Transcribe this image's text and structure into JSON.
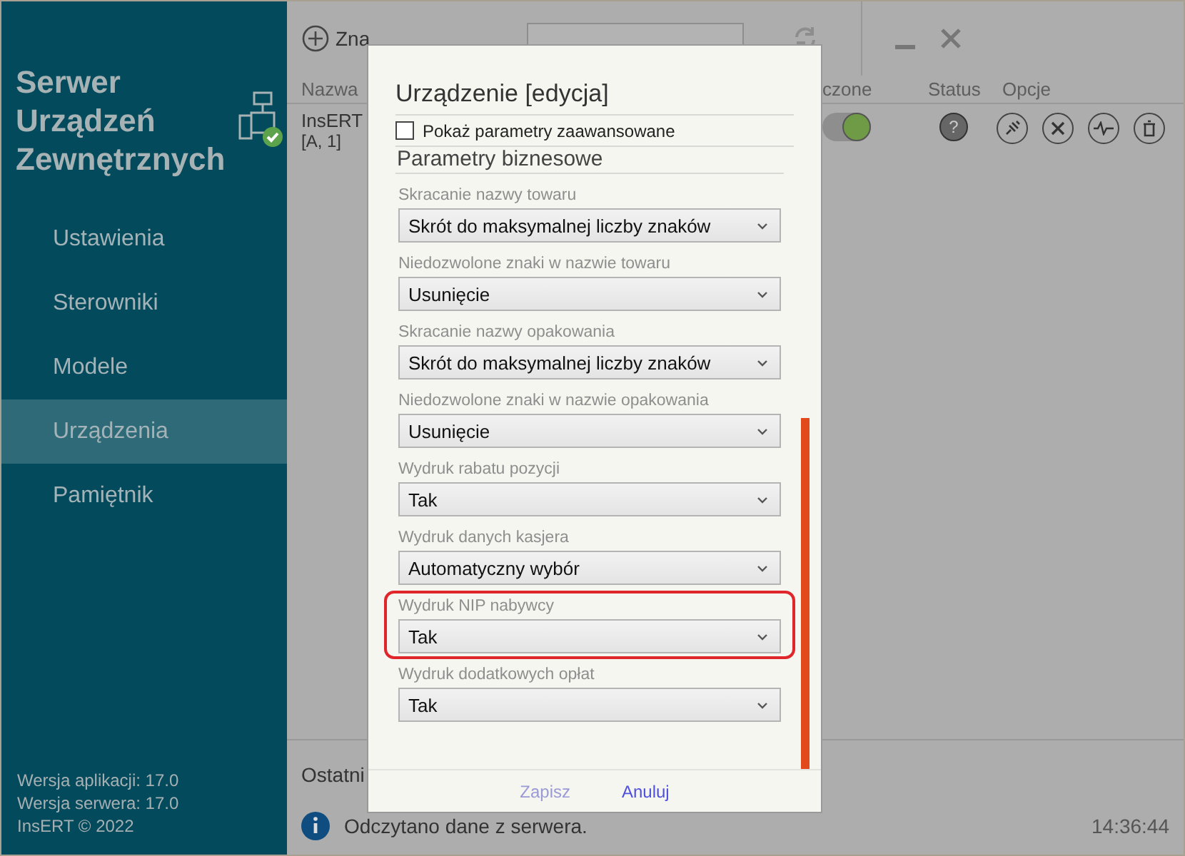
{
  "sidebar": {
    "title": [
      "Serwer",
      "Urządzeń",
      "Zewnętrznych"
    ],
    "items": [
      {
        "label": "Ustawienia",
        "selected": false
      },
      {
        "label": "Sterowniki",
        "selected": false
      },
      {
        "label": "Modele",
        "selected": false
      },
      {
        "label": "Urządzenia",
        "selected": true
      },
      {
        "label": "Pamiętnik",
        "selected": false
      }
    ],
    "footer": [
      "Wersja aplikacji: 17.0",
      "Wersja serwera: 17.0",
      "InsERT © 2022"
    ]
  },
  "toolbar": {
    "add_label": "Zna"
  },
  "table": {
    "columns": [
      "Nazwa",
      "czone",
      "Status",
      "Opcje"
    ],
    "rows": [
      {
        "name": "InsERT",
        "sub": "[A, 1]",
        "on": true,
        "status": "?"
      }
    ]
  },
  "log": {
    "title": "Ostatni",
    "message": "Odczytano dane z serwera.",
    "time": "14:36:44"
  },
  "dialog": {
    "title": "Urządzenie [edycja]",
    "advanced": {
      "label": "Pokaż parametry zaawansowane",
      "checked": false
    },
    "section": "Parametry biznesowe",
    "fields": [
      {
        "label": "Skracanie nazwy towaru",
        "value": "Skrót do maksymalnej liczby znaków",
        "highlighted": false
      },
      {
        "label": "Niedozwolone znaki w nazwie towaru",
        "value": "Usunięcie",
        "highlighted": false
      },
      {
        "label": "Skracanie nazwy opakowania",
        "value": "Skrót do maksymalnej liczby znaków",
        "highlighted": false
      },
      {
        "label": "Niedozwolone znaki w nazwie opakowania",
        "value": "Usunięcie",
        "highlighted": false
      },
      {
        "label": "Wydruk rabatu pozycji",
        "value": "Tak",
        "highlighted": false
      },
      {
        "label": "Wydruk danych kasjera",
        "value": "Automatyczny wybór",
        "highlighted": false
      },
      {
        "label": "Wydruk NIP nabywcy",
        "value": "Tak",
        "highlighted": true
      },
      {
        "label": "Wydruk dodatkowych opłat",
        "value": "Tak",
        "highlighted": false
      }
    ],
    "buttons": [
      {
        "label": "Zapisz",
        "disabled": true
      },
      {
        "label": "Anuluj",
        "disabled": false
      }
    ]
  }
}
